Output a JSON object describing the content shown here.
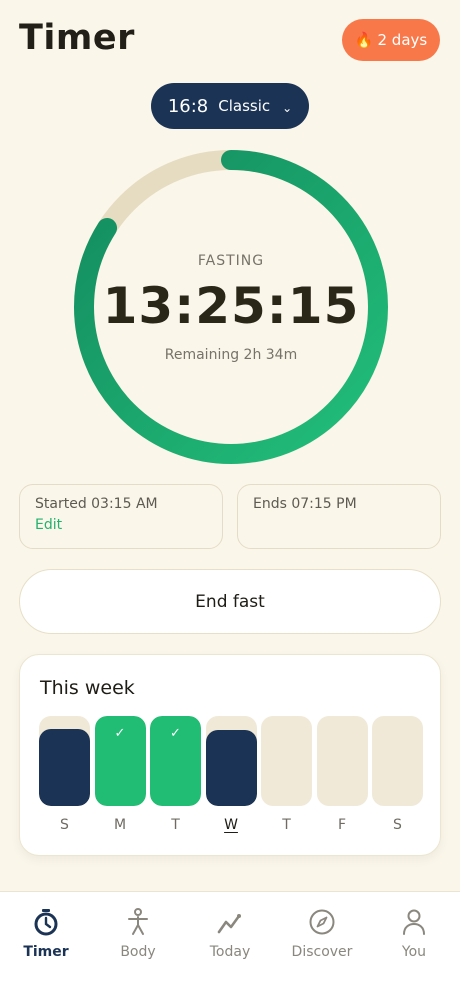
{
  "header": {
    "title": "Timer",
    "streak_label": "2 days",
    "streak_icon": "fire-icon"
  },
  "plan": {
    "ratio": "16:8",
    "name": "Classic",
    "chevron": "⌄"
  },
  "timer": {
    "state_label": "FASTING",
    "elapsed": "13:25:15",
    "remaining": "Remaining 2h 34m",
    "progress_fraction": 0.84,
    "colors": {
      "track": "#e6dcc2",
      "progress_start": "#22c07b",
      "progress_end": "#138a5e"
    }
  },
  "info": {
    "started": "Started 03:15 AM",
    "edit": "Edit",
    "ends": "Ends 07:15 PM"
  },
  "actions": {
    "end_fast": "End fast"
  },
  "week": {
    "title": "This week",
    "days": [
      {
        "letter": "S",
        "fill_fraction": 0.86,
        "status": "partial",
        "color": "#1b3355",
        "checked": false,
        "current": false
      },
      {
        "letter": "M",
        "fill_fraction": 1.0,
        "status": "complete",
        "color": "#22bd74",
        "checked": true,
        "current": false
      },
      {
        "letter": "T",
        "fill_fraction": 1.0,
        "status": "complete",
        "color": "#22bd74",
        "checked": true,
        "current": false
      },
      {
        "letter": "W",
        "fill_fraction": 0.84,
        "status": "in-progress",
        "color": "#1b3355",
        "checked": false,
        "current": true
      },
      {
        "letter": "T",
        "fill_fraction": 0,
        "status": "empty",
        "color": "",
        "checked": false,
        "current": false
      },
      {
        "letter": "F",
        "fill_fraction": 0,
        "status": "empty",
        "color": "",
        "checked": false,
        "current": false
      },
      {
        "letter": "S",
        "fill_fraction": 0,
        "status": "empty",
        "color": "",
        "checked": false,
        "current": false
      }
    ],
    "check_glyph": "✓"
  },
  "nav": {
    "items": [
      {
        "label": "Timer",
        "icon": "stopwatch-icon",
        "active": true
      },
      {
        "label": "Body",
        "icon": "person-icon",
        "active": false
      },
      {
        "label": "Today",
        "icon": "trend-icon",
        "active": false
      },
      {
        "label": "Discover",
        "icon": "compass-icon",
        "active": false
      },
      {
        "label": "You",
        "icon": "profile-icon",
        "active": false
      }
    ]
  }
}
